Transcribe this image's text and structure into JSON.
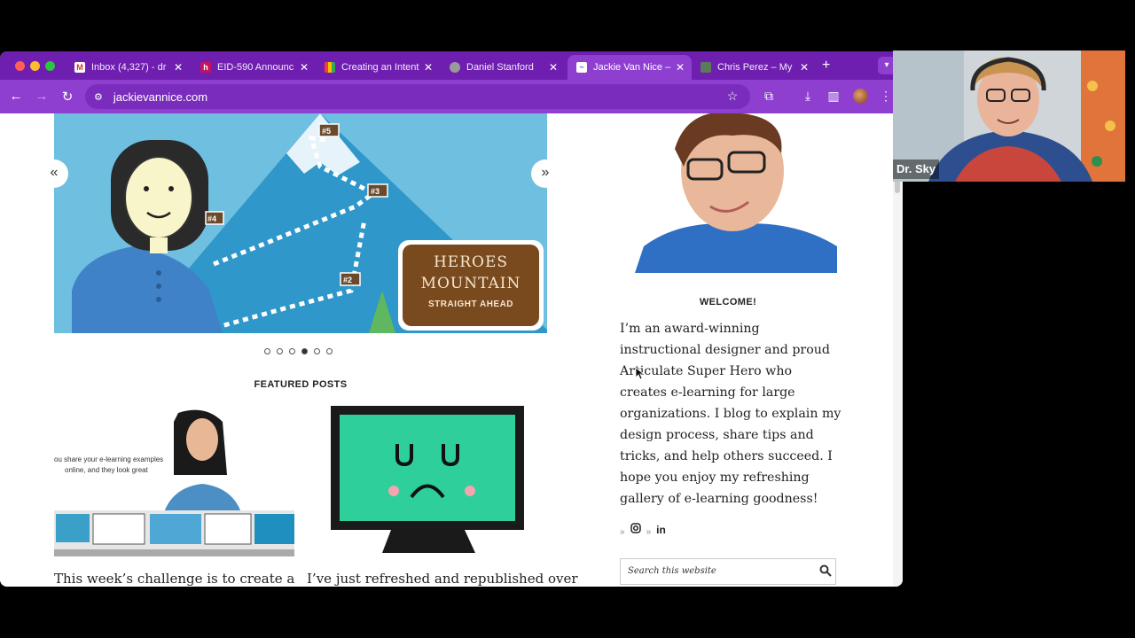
{
  "browser": {
    "tabs": [
      {
        "label": "Inbox (4,327) - dr",
        "icon": "gmail-icon",
        "active": false
      },
      {
        "label": "EID-590 Announc",
        "icon": "course-icon",
        "active": false
      },
      {
        "label": "Creating an Intent",
        "icon": "doc-icon",
        "active": false
      },
      {
        "label": "Daniel Stanford",
        "icon": "globe-icon",
        "active": false
      },
      {
        "label": "Jackie Van Nice –",
        "icon": "site-icon",
        "active": true
      },
      {
        "label": "Chris Perez – My",
        "icon": "site-icon",
        "active": false
      }
    ],
    "url": "jackievannice.com",
    "accent_color": "#8e3fd0",
    "tabbar_color": "#6f1fb0"
  },
  "page": {
    "slider": {
      "prev_label": "«",
      "next_label": "»",
      "sign_line1": "HEROES",
      "sign_line2": "MOUNTAIN",
      "sign_line3": "STRAIGHT AHEAD",
      "markers": [
        "#5",
        "#4",
        "#3",
        "#2"
      ],
      "current_slide": 4,
      "total_slides": 6
    },
    "featured_title": "FEATURED POSTS",
    "posts": [
      {
        "image_caption_line1": "ou share your e-learning examples",
        "image_caption_line2": "online, and they look great",
        "excerpt": "This week’s challenge is to create a"
      },
      {
        "excerpt": "I’ve just refreshed and republished over"
      }
    ],
    "sidebar": {
      "welcome_title": "WELCOME!",
      "welcome_text": "I’m an award-winning instructional designer and proud Articulate Super Hero who creates e-learning for large organizations. I blog to explain my design process, share tips and tricks, and help others succeed. I hope you enjoy my refreshing gallery of e-learning goodness!",
      "social": [
        {
          "chevron": "»",
          "icon": "instagram-icon"
        },
        {
          "chevron": "»",
          "icon": "linkedin-icon",
          "label": "in"
        }
      ],
      "search_placeholder": "Search this website"
    }
  },
  "video_call": {
    "participant_name": "Dr. Sky"
  }
}
